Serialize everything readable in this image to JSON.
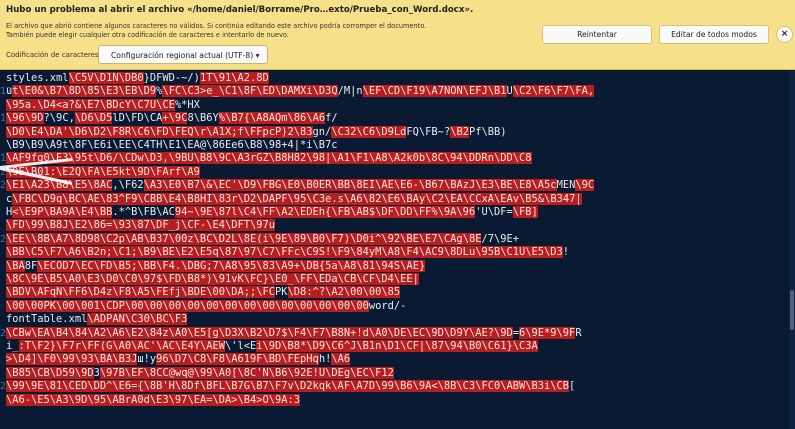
{
  "infobar": {
    "title": "Hubo un problema al abrir el archivo «/home/daniel/Borrame/Pro…exto/Prueba_con_Word.docx».",
    "message_line1": "El archivo que abrió contiene algunos caracteres no válidos. Si continúa editando este archivo podría corromper el documento.",
    "message_line2": "También puede elegir cualquier otra codificación de caracteres e intentarlo de nuevo.",
    "encoding_label": "Codificación de caracteres:",
    "encoding_value": "Configuración regional actual (UTF-8) ▾",
    "retry_label": "Reintentar",
    "edit_anyway_label": "Editar de todos modos",
    "close_label": "×",
    "colors": {
      "background": "#f7e08a",
      "button": "#fafafa"
    }
  },
  "editor": {
    "colors": {
      "background": "#0a1a33",
      "invalid_highlight": "#b81e1e",
      "line_number": "#3b6fb0"
    },
    "lines": [
      {
        "n": "",
        "segs": [
          {
            "t": "styles.xml",
            "b": false
          },
          {
            "t": "\\C5V\\D1N\\DB0",
            "b": true
          },
          {
            "t": "}DFWD-~/)",
            "b": false
          },
          {
            "t": "1T\\91\\A2.",
            "b": true
          },
          {
            "t": "8D",
            "b": true
          }
        ]
      },
      {
        "n": "17",
        "segs": [
          {
            "t": "u",
            "b": false
          },
          {
            "t": "t",
            "b": true
          },
          {
            "t": "\\E0&\\B7\\8D\\85\\E3\\EB\\D9",
            "b": true
          },
          {
            "t": "%",
            "b": false
          },
          {
            "t": "\\FC\\C3>e_\\C1\\8F\\ED\\DAMXi\\D3Q",
            "b": true
          },
          {
            "t": "/M|n",
            "b": false
          },
          {
            "t": "\\EF\\CD\\F19\\A7NON\\EFJ",
            "b": true
          },
          {
            "t": "\\B1",
            "b": true
          },
          {
            "t": "U",
            "b": false
          },
          {
            "t": "\\C2\\F6\\F7\\FA,",
            "b": true
          }
        ]
      },
      {
        "n": "",
        "segs": [
          {
            "t": "\\95a.\\D4<a?&\\E7\\BDc",
            "b": true
          },
          {
            "t": "Y\\C7U\\CE",
            "b": true
          },
          {
            "t": "%*HX",
            "b": false
          }
        ]
      },
      {
        "n": "18",
        "segs": [
          {
            "t": "\\96\\9D",
            "b": true
          },
          {
            "t": "?\\9C,",
            "b": false
          },
          {
            "t": "\\D6\\D5",
            "b": true
          },
          {
            "t": "lD\\FD\\CA",
            "b": false
          },
          {
            "t": "+\\9C",
            "b": true
          },
          {
            "t": "8\\B6Y",
            "b": false
          },
          {
            "t": "%\\B7{\\A8AQm\\86\\A6",
            "b": true
          },
          {
            "t": "f/",
            "b": false
          }
        ]
      },
      {
        "n": "",
        "segs": [
          {
            "t": "\\D0\\E4\\DA'",
            "b": true
          },
          {
            "t": "\\D6\\D2\\F8R\\C6",
            "b": true
          },
          {
            "t": "\\FD\\FEQ\\r\\A1X;f\\FFpcP)2\\83",
            "b": true
          },
          {
            "t": "gn/",
            "b": false
          },
          {
            "t": "\\C32\\C6\\D9Ld",
            "b": true
          },
          {
            "t": "FQ\\FB~?",
            "b": false
          },
          {
            "t": "\\B2",
            "b": true
          },
          {
            "t": "Pf\\BB",
            "b": false
          },
          {
            "t": ")",
            "b": false
          }
        ]
      },
      {
        "n": "",
        "segs": [
          {
            "t": "\\B9\\B9\\A9t\\8F\\E6i\\EE\\C4TH\\E1\\EA@\\86Ee6\\B8\\98+4|*i\\B7c",
            "b": false
          }
        ]
      },
      {
        "n": "19",
        "segs": [
          {
            "t": "\\AF9fg0\\E3\\95t\\D6/\\CDw\\D3,\\9BU\\B8\\9C\\A3rGZ\\B8H82\\98|\\A1\\F1\\A8\\A2k0b\\8C\\94\\DDR",
            "b": true
          },
          {
            "t": "n\\DD\\C8",
            "b": true
          }
        ]
      },
      {
        "n": "20",
        "segs": [
          {
            "t": "\\9E\\B01:\\E2Q\\FA\\E5kt\\9D\\FArf\\A9",
            "b": true
          }
        ]
      },
      {
        "n": "21",
        "segs": [
          {
            "t": "\\E1\\A23\\B8\\E5\\8AC",
            "b": true
          },
          {
            "t": ",\\F62",
            "b": false
          },
          {
            "t": "\\A3\\E0",
            "b": true
          },
          {
            "t": "\\B7\\&\\EC'",
            "b": true
          },
          {
            "t": "\\D9\\FBG\\E0\\B0ER\\BB\\8EI\\AE\\E6-",
            "b": true
          },
          {
            "t": "\\B67\\BAzJ\\E3\\BE\\E8\\A5c",
            "b": true
          },
          {
            "t": "MEN",
            "b": false
          },
          {
            "t": "\\9C",
            "b": true
          }
        ]
      },
      {
        "n": "",
        "segs": [
          {
            "t": "c",
            "b": false
          },
          {
            "t": "\\FBC\\D9q\\BC\\AE\\83^",
            "b": true
          },
          {
            "t": "F9\\CBB\\E4\\B8HI",
            "b": true
          },
          {
            "t": "\\83r",
            "b": true
          },
          {
            "t": "\\D2\\DAP",
            "b": true
          },
          {
            "t": "F\\95\\C3e.",
            "b": true
          },
          {
            "t": "s\\A6\\82\\E6",
            "b": true
          },
          {
            "t": "\\BAy\\C2\\EA\\CCx",
            "b": true
          },
          {
            "t": "A\\EAv\\B5&\\B347|",
            "b": true
          }
        ]
      },
      {
        "n": "",
        "segs": [
          {
            "t": "H",
            "b": false
          },
          {
            "t": "<\\E9P\\BA",
            "b": true
          },
          {
            "t": "9A\\E4\\BB",
            "b": true
          },
          {
            "t": ".*^B\\FB\\AC",
            "b": false
          },
          {
            "t": "94~\\9E\\87l\\C4\\FF\\A2\\EDEh{\\FB\\AB$\\DF\\DD\\FF",
            "b": true
          },
          {
            "t": "%\\9A\\96",
            "b": true
          },
          {
            "t": "'U\\DF=",
            "b": false
          },
          {
            "t": "\\FB]",
            "b": true
          }
        ]
      },
      {
        "n": "",
        "segs": [
          {
            "t": "\\FD\\99\\B8J\\E2\\86=\\93\\87\\DF",
            "b": true
          },
          {
            "t": "_j\\CF-\\E4\\DFT\\97u",
            "b": true
          }
        ]
      },
      {
        "n": "22",
        "segs": [
          {
            "t": "\\EE\\\\8B\\A7",
            "b": true
          },
          {
            "t": "\\8D98\\C2p\\AB\\B37\\00z\\BC\\D2L\\8E(i\\9E\\89\\B0\\F7)\\D0i",
            "b": true
          },
          {
            "t": "^\\92\\BE\\E7\\CAg",
            "b": true
          },
          {
            "t": "\\8E",
            "b": true
          },
          {
            "t": "/7\\9E+",
            "b": false
          }
        ]
      },
      {
        "n": "",
        "segs": [
          {
            "t": "\\BB\\C5\\F7\\A6\\B2n;\\C1;\\B9\\BE\\E2\\E5q\\87\\97\\C7\\FFc\\C9S!",
            "b": true
          },
          {
            "t": "\\F9\\84y",
            "b": true
          },
          {
            "t": "M\\A8\\F4\\AC9\\8DL",
            "b": true
          },
          {
            "t": "u\\95B\\C1U\\E5",
            "b": true
          },
          {
            "t": "\\D3",
            "b": true
          },
          {
            "t": "!",
            "b": false
          }
        ]
      },
      {
        "n": "",
        "segs": [
          {
            "t": "\\BA",
            "b": true
          },
          {
            "t": "8F",
            "b": false
          },
          {
            "t": "\\ECOD7\\EC",
            "b": true
          },
          {
            "t": "\\FD\\B5;\\BB",
            "b": true
          },
          {
            "t": "\\F4.\\DBG;7",
            "b": true
          },
          {
            "t": "\\A8\\95\\83\\A9+",
            "b": true
          },
          {
            "t": "\\DB",
            "b": true
          },
          {
            "t": "{5a\\A8\\81",
            "b": true
          },
          {
            "t": "\\94S\\AE}",
            "b": true
          }
        ]
      },
      {
        "n": "",
        "segs": [
          {
            "t": "\\8C\\9E\\B5\\A0\\E3",
            "b": true
          },
          {
            "t": "\\D0",
            "b": true
          },
          {
            "t": "\\C0\\97$\\FD\\B8*)\\91vK\\FC}\\E0_",
            "b": true
          },
          {
            "t": "\\FF\\EDa",
            "b": true
          },
          {
            "t": "\\CB\\CF\\D4\\EE|",
            "b": true
          }
        ]
      },
      {
        "n": "",
        "segs": [
          {
            "t": "\\BDV\\AFqN\\FF",
            "b": true
          },
          {
            "t": "6\\D4z\\F8\\A5",
            "b": true
          },
          {
            "t": "\\FEfj\\BDE\\00\\DA;;\\FC",
            "b": true
          },
          {
            "t": "PK",
            "b": false
          },
          {
            "t": "\\D8:^?\\A2",
            "b": true
          },
          {
            "t": "\\00\\00\\85",
            "b": true
          }
        ]
      },
      {
        "n": "",
        "segs": [
          {
            "t": "\\00\\00PK",
            "b": true
          },
          {
            "t": "\\00",
            "b": true
          },
          {
            "t": "\\001",
            "b": true
          },
          {
            "t": "\\CDP\\00\\00\\00\\00\\00\\00\\00\\00",
            "b": true
          },
          {
            "t": "\\00\\00\\00\\00\\00",
            "b": true
          },
          {
            "t": "word/-",
            "b": false
          }
        ]
      },
      {
        "n": "",
        "segs": [
          {
            "t": "fontTable.xml",
            "b": false
          },
          {
            "t": "\\ADPAN\\C30",
            "b": true
          },
          {
            "t": "\\BC\\F3",
            "b": true
          }
        ]
      },
      {
        "n": "23",
        "segs": [
          {
            "t": "\\CBw\\EA\\B4",
            "b": true
          },
          {
            "t": "\\84\\A2\\A6",
            "b": true
          },
          {
            "t": "\\E2\\84z\\A0\\E5",
            "b": true
          },
          {
            "t": "[g\\D3X\\B2",
            "b": true
          },
          {
            "t": "\\D7$\\F4\\F7\\B8N+!d\\A0\\DE\\EC\\9D\\D9Y\\AE?\\9D",
            "b": true
          },
          {
            "t": "=",
            "b": false
          },
          {
            "t": "6\\9E*9\\9F",
            "b": true
          },
          {
            "t": "R",
            "b": false
          }
        ]
      },
      {
        "n": "",
        "segs": [
          {
            "t": "i_",
            "b": false
          },
          {
            "t": ":T\\F2}\\F7r\\FF(",
            "b": true
          },
          {
            "t": "G\\A0",
            "b": true
          },
          {
            "t": "\\AC'\\AC\\E4",
            "b": true
          },
          {
            "t": "Y\\AEW",
            "b": true
          },
          {
            "t": "\\'l<E",
            "b": false
          },
          {
            "t": "i\\9D\\B8",
            "b": true
          },
          {
            "t": "*\\D9\\C6^J\\B1n\\D1",
            "b": true
          },
          {
            "t": "\\CF|\\87\\94\\B0\\C6",
            "b": true
          },
          {
            "t": "1}\\C3A",
            "b": true
          }
        ]
      },
      {
        "n": "",
        "segs": [
          {
            "t": ">\\D4]\\F0",
            "b": true
          },
          {
            "t": "\\99\\93\\BA\\B3J",
            "b": true
          },
          {
            "t": "ш!y",
            "b": false
          },
          {
            "t": "96\\D7\\C8\\F8\\A61",
            "b": true
          },
          {
            "t": "9F\\BD\\FEpHq",
            "b": true
          },
          {
            "t": "h!",
            "b": false
          },
          {
            "t": "\\A6",
            "b": true
          }
        ]
      },
      {
        "n": "",
        "segs": [
          {
            "t": "\\B85",
            "b": true
          },
          {
            "t": "\\CB\\D59\\9D",
            "b": true
          },
          {
            "t": "3",
            "b": false
          },
          {
            "t": "\\97B\\EF\\8CC",
            "b": true
          },
          {
            "t": "@wq@\\99\\A0[",
            "b": true
          },
          {
            "t": "\\8C'N",
            "b": true
          },
          {
            "t": "\\B6\\92E!U\\DE",
            "b": true
          },
          {
            "t": "g\\EC\\F12",
            "b": true
          }
        ]
      },
      {
        "n": "25",
        "segs": [
          {
            "t": "\\99\\9E\\81\\CED\\DD^\\E6=",
            "b": true
          },
          {
            "t": "{\\8B'H\\8Df\\BFL\\B7G\\B7\\F7v\\D2kqk\\AF\\A7D\\99\\B6\\9A<\\8B",
            "b": true
          },
          {
            "t": "\\C3\\FC0\\ABW\\B3i\\CB",
            "b": true
          },
          {
            "t": "[",
            "b": false
          }
        ]
      },
      {
        "n": "",
        "segs": [
          {
            "t": "\\A6",
            "b": true
          },
          {
            "t": "-\\E5\\A3",
            "b": true
          },
          {
            "t": "\\9D\\95\\ABrA0d\\E3",
            "b": true
          },
          {
            "t": "\\97\\EA=",
            "b": true
          },
          {
            "t": "\\DA>\\B4>O\\9A:3",
            "b": true
          }
        ]
      }
    ]
  }
}
